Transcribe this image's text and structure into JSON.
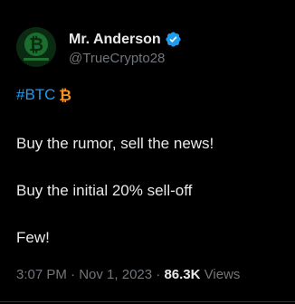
{
  "author": {
    "display_name": "Mr. Anderson",
    "handle": "@TrueCrypto28",
    "verified_color": "#1d9bf0",
    "avatar_label": "#TrueCrypto28"
  },
  "tweet": {
    "hashtag": "#BTC",
    "hashtag_emoji": "bitcoin-icon",
    "line_1": "Buy the rumor, sell the news!",
    "line_2": "Buy the initial 20% sell-off",
    "line_3": "Few!"
  },
  "meta": {
    "time": "3:07 PM",
    "separator_1": "·",
    "date": "Nov 1, 2023",
    "separator_2": "·",
    "views_count": "86.3K",
    "views_label": "Views"
  },
  "colors": {
    "background": "#000000",
    "text": "#e7e9ea",
    "secondary": "#71767b",
    "accent": "#1d9bf0",
    "bitcoin": "#f7931a"
  }
}
